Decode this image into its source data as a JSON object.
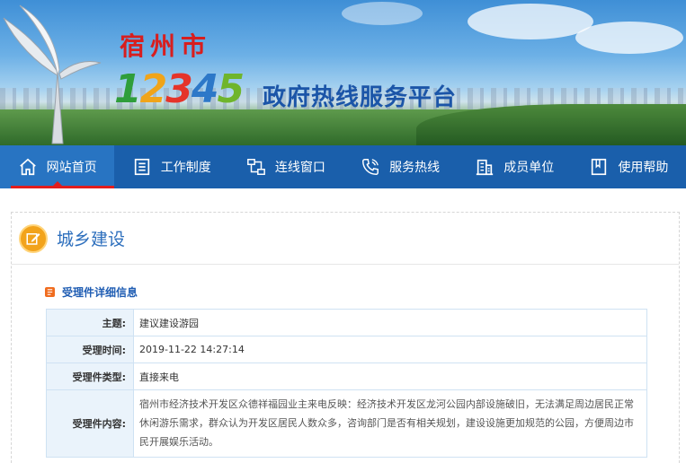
{
  "banner": {
    "city": "宿州市",
    "number_digits": [
      "1",
      "2",
      "3",
      "4",
      "5"
    ],
    "number_colors": [
      "#2f9e3a",
      "#f0a419",
      "#e5342a",
      "#2d78c8",
      "#6fb52c"
    ],
    "platform": "政府热线服务平台"
  },
  "nav": {
    "items": [
      {
        "label": "网站首页",
        "icon": "home-icon",
        "active": true
      },
      {
        "label": "工作制度",
        "icon": "list-icon",
        "active": false
      },
      {
        "label": "连线窗口",
        "icon": "network-icon",
        "active": false
      },
      {
        "label": "服务热线",
        "icon": "phone-icon",
        "active": false
      },
      {
        "label": "成员单位",
        "icon": "building-icon",
        "active": false
      },
      {
        "label": "使用帮助",
        "icon": "book-icon",
        "active": false
      }
    ]
  },
  "section": {
    "title": "城乡建设",
    "subtitle": "受理件详细信息"
  },
  "details": {
    "rows": [
      {
        "key": "主题:",
        "value": "建议建设游园"
      },
      {
        "key": "受理时间:",
        "value": "2019-11-22 14:27:14"
      },
      {
        "key": "受理件类型:",
        "value": "直接来电"
      },
      {
        "key": "受理件内容:",
        "value": "宿州市经济技术开发区众德祥福园业主来电反映：经济技术开发区龙河公园内部设施破旧，无法满足周边居民正常休闲游乐需求，群众认为开发区居民人数众多，咨询部门是否有相关规划，建设设施更加规范的公园，方便周边市民开展娱乐活动。"
      }
    ]
  },
  "colors": {
    "nav_bg": "#1a5fab",
    "accent_red": "#e11d1d",
    "section_blue": "#2d6fbd",
    "badge_orange": "#f2a31b"
  }
}
